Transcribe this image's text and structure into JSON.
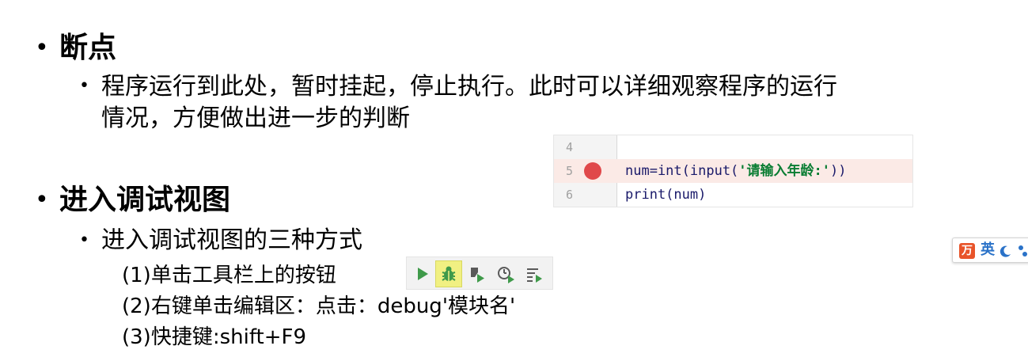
{
  "section1": {
    "title": "断点",
    "item": {
      "line1": "程序运行到此处，暂时挂起，停止执行。此时可以详细观察程序的运行",
      "line2": "情况，方便做出进一步的判断"
    }
  },
  "code": {
    "lines": [
      {
        "number": "4",
        "text": ""
      },
      {
        "number": "5",
        "prefix": "num=int(input(",
        "string": "'请输入年龄:'",
        "suffix": "))",
        "breakpoint": true
      },
      {
        "number": "6",
        "text": "print(num)"
      }
    ],
    "colors": {
      "breakpoint": "#e0484a",
      "highlight_row": "#fbeae6",
      "string": "#0a7d33",
      "keyword": "#1a1a6a"
    }
  },
  "section2": {
    "title": "进入调试视图",
    "item": "进入调试视图的三种方式",
    "methods": [
      "(1)单击工具栏上的按钮",
      "(2)右键单击编辑区：点击：debug'模块名'",
      "(3)快捷键:shift+F9"
    ]
  },
  "toolbar": {
    "buttons": [
      {
        "icon": "run-icon"
      },
      {
        "icon": "debug-bug-icon",
        "active": true
      },
      {
        "icon": "run-with-coverage-icon"
      },
      {
        "icon": "profile-icon"
      },
      {
        "icon": "run-concurrency-icon"
      }
    ],
    "colors": {
      "green": "#3f9a4a",
      "active_bg": "#f1f082",
      "gray": "#5a5a5a"
    }
  },
  "ime": {
    "logo_glyph": "万",
    "language": "英"
  }
}
